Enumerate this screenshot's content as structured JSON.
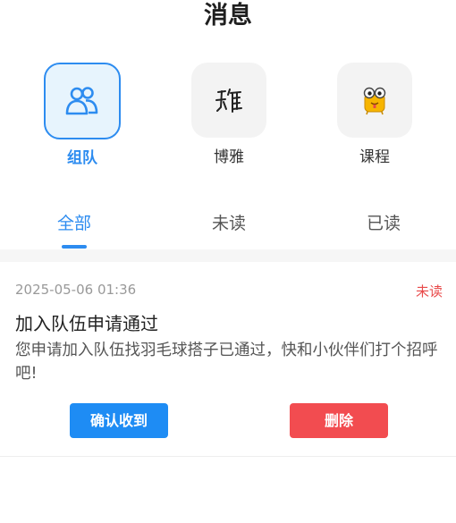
{
  "header": {
    "title": "消息"
  },
  "categories": [
    {
      "label": "组队",
      "icon": "team-icon",
      "active": true
    },
    {
      "label": "博雅",
      "icon": "boya-calligraphy-icon",
      "active": false
    },
    {
      "label": "课程",
      "icon": "course-mascot-icon",
      "active": false
    }
  ],
  "tabs": [
    {
      "label": "全部",
      "active": true
    },
    {
      "label": "未读",
      "active": false
    },
    {
      "label": "已读",
      "active": false
    }
  ],
  "messages": [
    {
      "time": "2025-05-06 01:36",
      "status": "未读",
      "title": "加入队伍申请通过",
      "body": "您申请加入队伍找羽毛球搭子已通过，快和小伙伴们打个招呼吧!",
      "confirm_label": "确认收到",
      "delete_label": "删除"
    }
  ],
  "colors": {
    "accent": "#2d8cf0",
    "unread": "#e84a4a",
    "delete": "#f24c50"
  }
}
